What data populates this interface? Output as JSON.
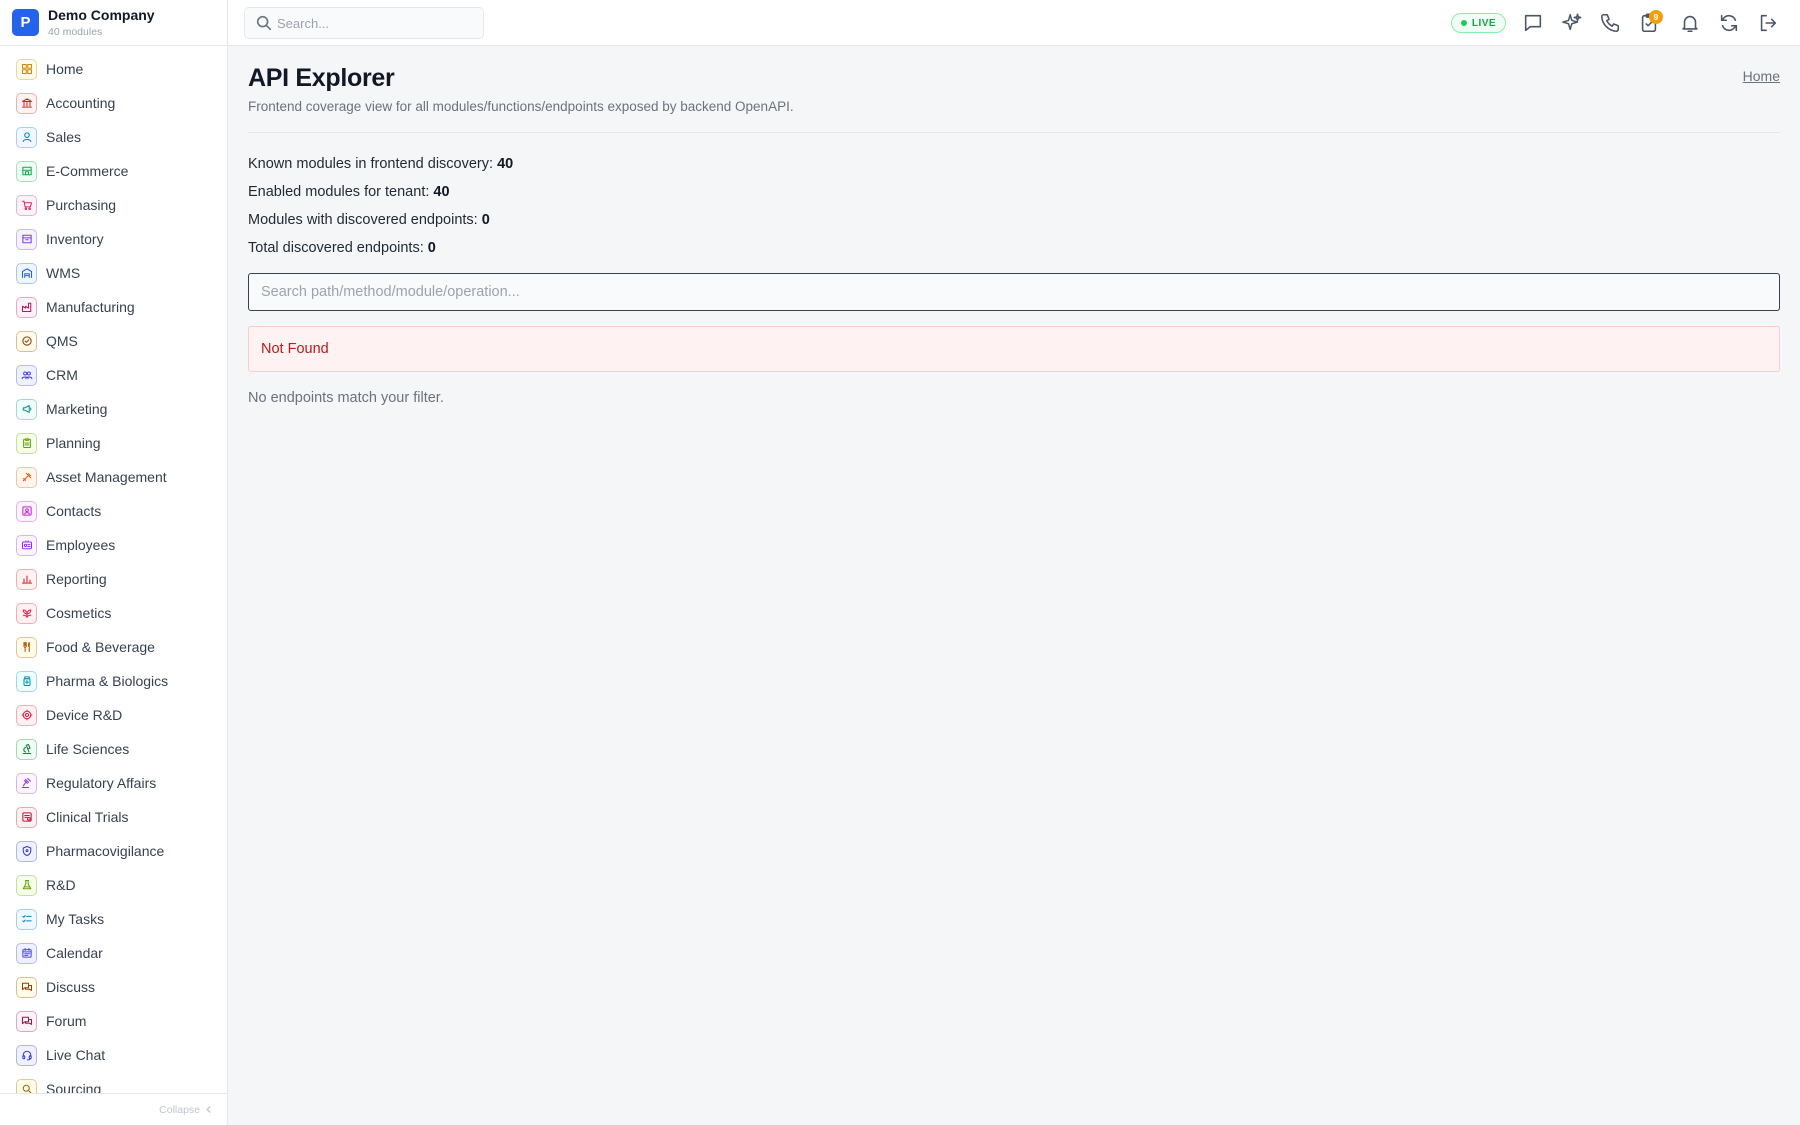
{
  "brand": {
    "logo_letter": "P",
    "name": "Demo Company",
    "subtitle": "40 modules"
  },
  "sidebar": {
    "items": [
      {
        "label": "Home",
        "icon": "grid-icon",
        "color": "#ca8a04",
        "bg": "#fefce8"
      },
      {
        "label": "Accounting",
        "icon": "bank-icon",
        "color": "#dc2626",
        "bg": "#fef2f2"
      },
      {
        "label": "Sales",
        "icon": "user-icon",
        "color": "#0284c7",
        "bg": "#f0f9ff"
      },
      {
        "label": "E-Commerce",
        "icon": "store-icon",
        "color": "#16a34a",
        "bg": "#f0fdf4"
      },
      {
        "label": "Purchasing",
        "icon": "cart-icon",
        "color": "#db2777",
        "bg": "#fdf2f8"
      },
      {
        "label": "Inventory",
        "icon": "box-icon",
        "color": "#7c3aed",
        "bg": "#f5f3ff"
      },
      {
        "label": "WMS",
        "icon": "warehouse-icon",
        "color": "#2563eb",
        "bg": "#eff6ff"
      },
      {
        "label": "Manufacturing",
        "icon": "factory-icon",
        "color": "#be185d",
        "bg": "#fdf2f8"
      },
      {
        "label": "QMS",
        "icon": "check-badge-icon",
        "color": "#92400e",
        "bg": "#fefce8"
      },
      {
        "label": "CRM",
        "icon": "users-icon",
        "color": "#4f46e5",
        "bg": "#eef2ff"
      },
      {
        "label": "Marketing",
        "icon": "megaphone-icon",
        "color": "#0d9488",
        "bg": "#f0fdfa"
      },
      {
        "label": "Planning",
        "icon": "clipboard-icon",
        "color": "#65a30d",
        "bg": "#f7fee7"
      },
      {
        "label": "Asset Management",
        "icon": "tools-icon",
        "color": "#ea580c",
        "bg": "#fff7ed"
      },
      {
        "label": "Contacts",
        "icon": "contact-icon",
        "color": "#c026d3",
        "bg": "#fdf4ff"
      },
      {
        "label": "Employees",
        "icon": "id-card-icon",
        "color": "#9333ea",
        "bg": "#faf5ff"
      },
      {
        "label": "Reporting",
        "icon": "bar-chart-icon",
        "color": "#dc2626",
        "bg": "#fef2f2"
      },
      {
        "label": "Cosmetics",
        "icon": "flower-icon",
        "color": "#e11d48",
        "bg": "#fff1f2"
      },
      {
        "label": "Food & Beverage",
        "icon": "utensils-icon",
        "color": "#b45309",
        "bg": "#fffbeb"
      },
      {
        "label": "Pharma & Biologics",
        "icon": "pill-bottle-icon",
        "color": "#0891b2",
        "bg": "#ecfeff"
      },
      {
        "label": "Device R&D",
        "icon": "cog-icon",
        "color": "#e11d48",
        "bg": "#fff1f2"
      },
      {
        "label": "Life Sciences",
        "icon": "microscope-icon",
        "color": "#15803d",
        "bg": "#f0fdf4"
      },
      {
        "label": "Regulatory Affairs",
        "icon": "gavel-icon",
        "color": "#9333ea",
        "bg": "#faf5ff"
      },
      {
        "label": "Clinical Trials",
        "icon": "clinical-icon",
        "color": "#be123c",
        "bg": "#fff1f2"
      },
      {
        "label": "Pharmacovigilance",
        "icon": "shield-icon",
        "color": "#4338ca",
        "bg": "#eef2ff"
      },
      {
        "label": "R&D",
        "icon": "flask-icon",
        "color": "#65a30d",
        "bg": "#f7fee7"
      },
      {
        "label": "My Tasks",
        "icon": "checklist-icon",
        "color": "#0284c7",
        "bg": "#f0f9ff"
      },
      {
        "label": "Calendar",
        "icon": "calendar-icon",
        "color": "#4f46e5",
        "bg": "#eef2ff"
      },
      {
        "label": "Discuss",
        "icon": "chat-icon",
        "color": "#92400e",
        "bg": "#fefce8"
      },
      {
        "label": "Forum",
        "icon": "forum-icon",
        "color": "#9d174d",
        "bg": "#fdf2f8"
      },
      {
        "label": "Live Chat",
        "icon": "headset-icon",
        "color": "#4338ca",
        "bg": "#eef2ff"
      },
      {
        "label": "Sourcing",
        "icon": "sourcing-icon",
        "color": "#a16207",
        "bg": "#fefce8"
      }
    ],
    "collapse_label": "Collapse"
  },
  "topbar": {
    "search_placeholder": "Search...",
    "live_label": "LIVE",
    "approvals_badge": "9"
  },
  "main": {
    "title": "API Explorer",
    "subtitle": "Frontend coverage view for all modules/functions/endpoints exposed by backend OpenAPI.",
    "home_link": "Home",
    "stats": [
      {
        "label": "Known modules in frontend discovery:",
        "value": "40"
      },
      {
        "label": "Enabled modules for tenant:",
        "value": "40"
      },
      {
        "label": "Modules with discovered endpoints:",
        "value": "0"
      },
      {
        "label": "Total discovered endpoints:",
        "value": "0"
      }
    ],
    "filter_placeholder": "Search path/method/module/operation...",
    "error_text": "Not Found",
    "empty_text": "No endpoints match your filter."
  }
}
